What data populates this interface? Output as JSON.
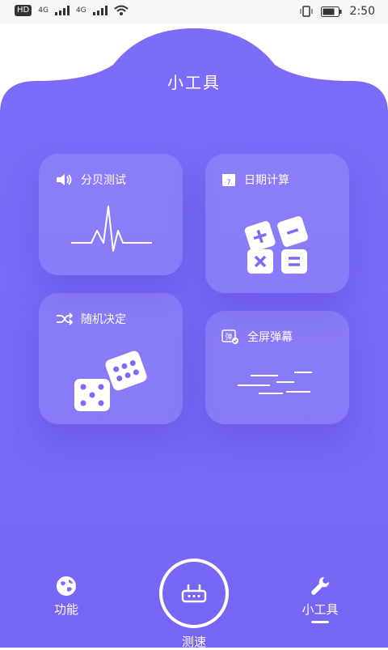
{
  "status_bar": {
    "left_badges": [
      "HD",
      "4G",
      "4G"
    ],
    "time": "2:50"
  },
  "header": {
    "title": "小工具"
  },
  "cards": [
    {
      "id": "decibel",
      "label": "分贝测试",
      "icon": "speaker-icon"
    },
    {
      "id": "date",
      "label": "日期计算",
      "icon": "calendar-icon",
      "calendar_day": "7"
    },
    {
      "id": "random",
      "label": "随机决定",
      "icon": "shuffle-icon"
    },
    {
      "id": "barrage",
      "label": "全屏弹幕",
      "icon": "barrage-icon",
      "icon_text": "弹"
    }
  ],
  "nav": {
    "func_label": "功能",
    "speed_label": "测速",
    "tools_label": "小工具"
  },
  "colors": {
    "primary": "#7a6cf7",
    "accent": "#6f5df2"
  }
}
